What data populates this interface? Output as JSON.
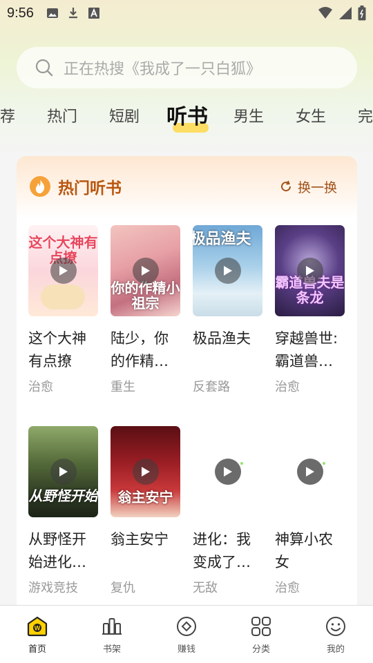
{
  "status": {
    "time": "9:56"
  },
  "search": {
    "placeholder": "正在热搜《我成了一只白狐》"
  },
  "tabs": [
    {
      "label": "荐"
    },
    {
      "label": "热门"
    },
    {
      "label": "短剧"
    },
    {
      "label": "听书"
    },
    {
      "label": "男生"
    },
    {
      "label": "女生"
    },
    {
      "label": "完"
    }
  ],
  "card": {
    "title": "热门听书",
    "refresh_label": "换一换"
  },
  "books": [
    {
      "title": "这个大神有点撩",
      "tag": "治愈",
      "cover_text": "这个大神有点撩"
    },
    {
      "title": "陆少，你的作精小祖宗",
      "tag": "重生",
      "cover_text": "你的作精小祖宗"
    },
    {
      "title": "极品渔夫",
      "tag": "反套路",
      "cover_text": "极品渔夫"
    },
    {
      "title": "穿越兽世:霸道兽夫是条龙",
      "tag": "治愈",
      "cover_text": "霸道兽夫是条龙"
    },
    {
      "title": "从野怪开始进化升级",
      "tag": "游戏竞技",
      "cover_text": "从野怪开始"
    },
    {
      "title": "翁主安宁",
      "tag": "复仇",
      "cover_text": "翁主安宁"
    },
    {
      "title": "进化：我变成了一只白狐",
      "tag": "无敌",
      "cover_text": ""
    },
    {
      "title": "神算小农女",
      "tag": "治愈",
      "cover_text": ""
    }
  ],
  "nav": [
    {
      "label": "首页",
      "icon": "home-icon"
    },
    {
      "label": "书架",
      "icon": "bookshelf-icon"
    },
    {
      "label": "赚钱",
      "icon": "earn-icon"
    },
    {
      "label": "分类",
      "icon": "category-icon"
    },
    {
      "label": "我的",
      "icon": "profile-icon"
    }
  ],
  "colors": {
    "accent": "#f28b1e",
    "title_brown": "#b8560f",
    "tab_highlight": "#ffd84a"
  }
}
